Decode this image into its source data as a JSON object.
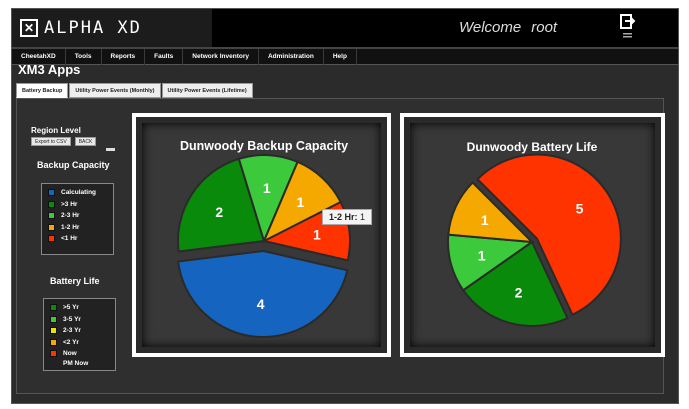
{
  "app": {
    "title": "ALPHA XD",
    "logo_glyph": "✕"
  },
  "header": {
    "welcome": "Welcome",
    "user": "root"
  },
  "menu": {
    "items": [
      "CheetahXD",
      "Tools",
      "Reports",
      "Faults",
      "Network Inventory",
      "Administration",
      "Help"
    ]
  },
  "page": {
    "title": "XM3 Apps"
  },
  "tabs": [
    "Battery Backup",
    "Utility Power Events (Monthly)",
    "Utility Power Events (Lifetime)"
  ],
  "sidebar": {
    "region_label": "Region Level",
    "export_label": "Export to CSV",
    "back_label": "BACK",
    "backup_title": "Backup Capacity",
    "backup_legend": [
      {
        "label": "Calculating",
        "color": "#1565c0"
      },
      {
        "label": ">3 Hr",
        "color": "#0a8a0a"
      },
      {
        "label": "2-3 Hr",
        "color": "#3cc93c"
      },
      {
        "label": "1-2 Hr",
        "color": "#f5a800"
      },
      {
        "label": "<1 Hr",
        "color": "#ff3300"
      }
    ],
    "battery_title": "Battery Life",
    "battery_legend": [
      {
        "label": ">5 Yr",
        "color": "#0a8a0a"
      },
      {
        "label": "3-5 Yr",
        "color": "#3cc93c"
      },
      {
        "label": "2-3 Yr",
        "color": "#e6e600"
      },
      {
        "label": "<2 Yr",
        "color": "#f5a800"
      },
      {
        "label": "Now",
        "color": "#ff3300"
      }
    ],
    "battery_extra": "PM Now"
  },
  "chart_data": [
    {
      "type": "pie",
      "title": "Dunwoody Backup Capacity",
      "categories": [
        "<1 Hr",
        "Calculating",
        ">3 Hr",
        "2-3 Hr",
        "1-2 Hr"
      ],
      "values": [
        1,
        4,
        2,
        1,
        1
      ],
      "colors": [
        "#ff3300",
        "#1565c0",
        "#0a8a0a",
        "#3cc93c",
        "#f5a800"
      ],
      "exploded": [
        "Calculating"
      ],
      "tooltip": {
        "label": "1-2 Hr:",
        "value": "1"
      }
    },
    {
      "type": "pie",
      "title": "Dunwoody Battery Life",
      "categories": [
        "Now",
        ">5 Yr",
        "3-5 Yr",
        "<2 Yr"
      ],
      "values": [
        5,
        2,
        1,
        1
      ],
      "colors": [
        "#ff3300",
        "#0a8a0a",
        "#3cc93c",
        "#f5a800"
      ],
      "exploded": [
        "Now"
      ]
    }
  ]
}
